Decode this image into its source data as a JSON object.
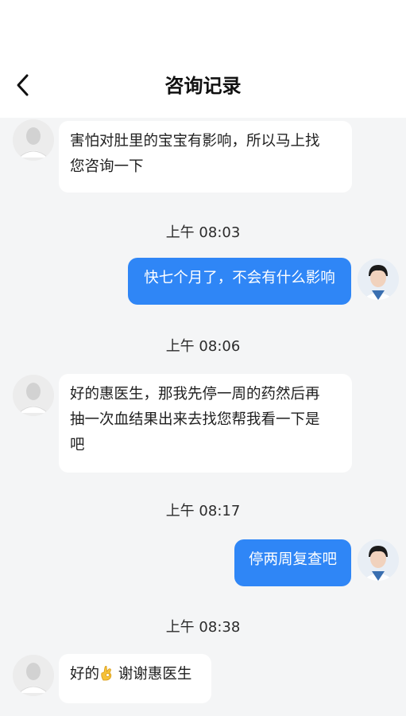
{
  "header": {
    "title": "咨询记录",
    "back_icon": "chevron-left-icon"
  },
  "messages": [
    {
      "side": "left",
      "lines": [
        "害怕对肚里的宝宝有影响，所以马上找",
        "您咨询一下"
      ]
    },
    {
      "time": "上午 08:03"
    },
    {
      "side": "right",
      "text": "快七个月了，不会有什么影响"
    },
    {
      "time": "上午 08:06"
    },
    {
      "side": "left",
      "lines": [
        "好的惠医生，那我先停一周的药然后再",
        "抽一次血结果出来去找您帮我看一下是",
        "吧"
      ]
    },
    {
      "time": "上午 08:17"
    },
    {
      "side": "right",
      "text": "停两周复查吧"
    },
    {
      "time": "上午 08:38"
    },
    {
      "side": "left",
      "before_emoji": "好的",
      "emoji": "👌",
      "after_emoji": " 谢谢惠医生"
    }
  ],
  "colors": {
    "outgoing_bubble": "#2f86f6",
    "incoming_bubble": "#ffffff",
    "background": "#f4f5f6"
  }
}
